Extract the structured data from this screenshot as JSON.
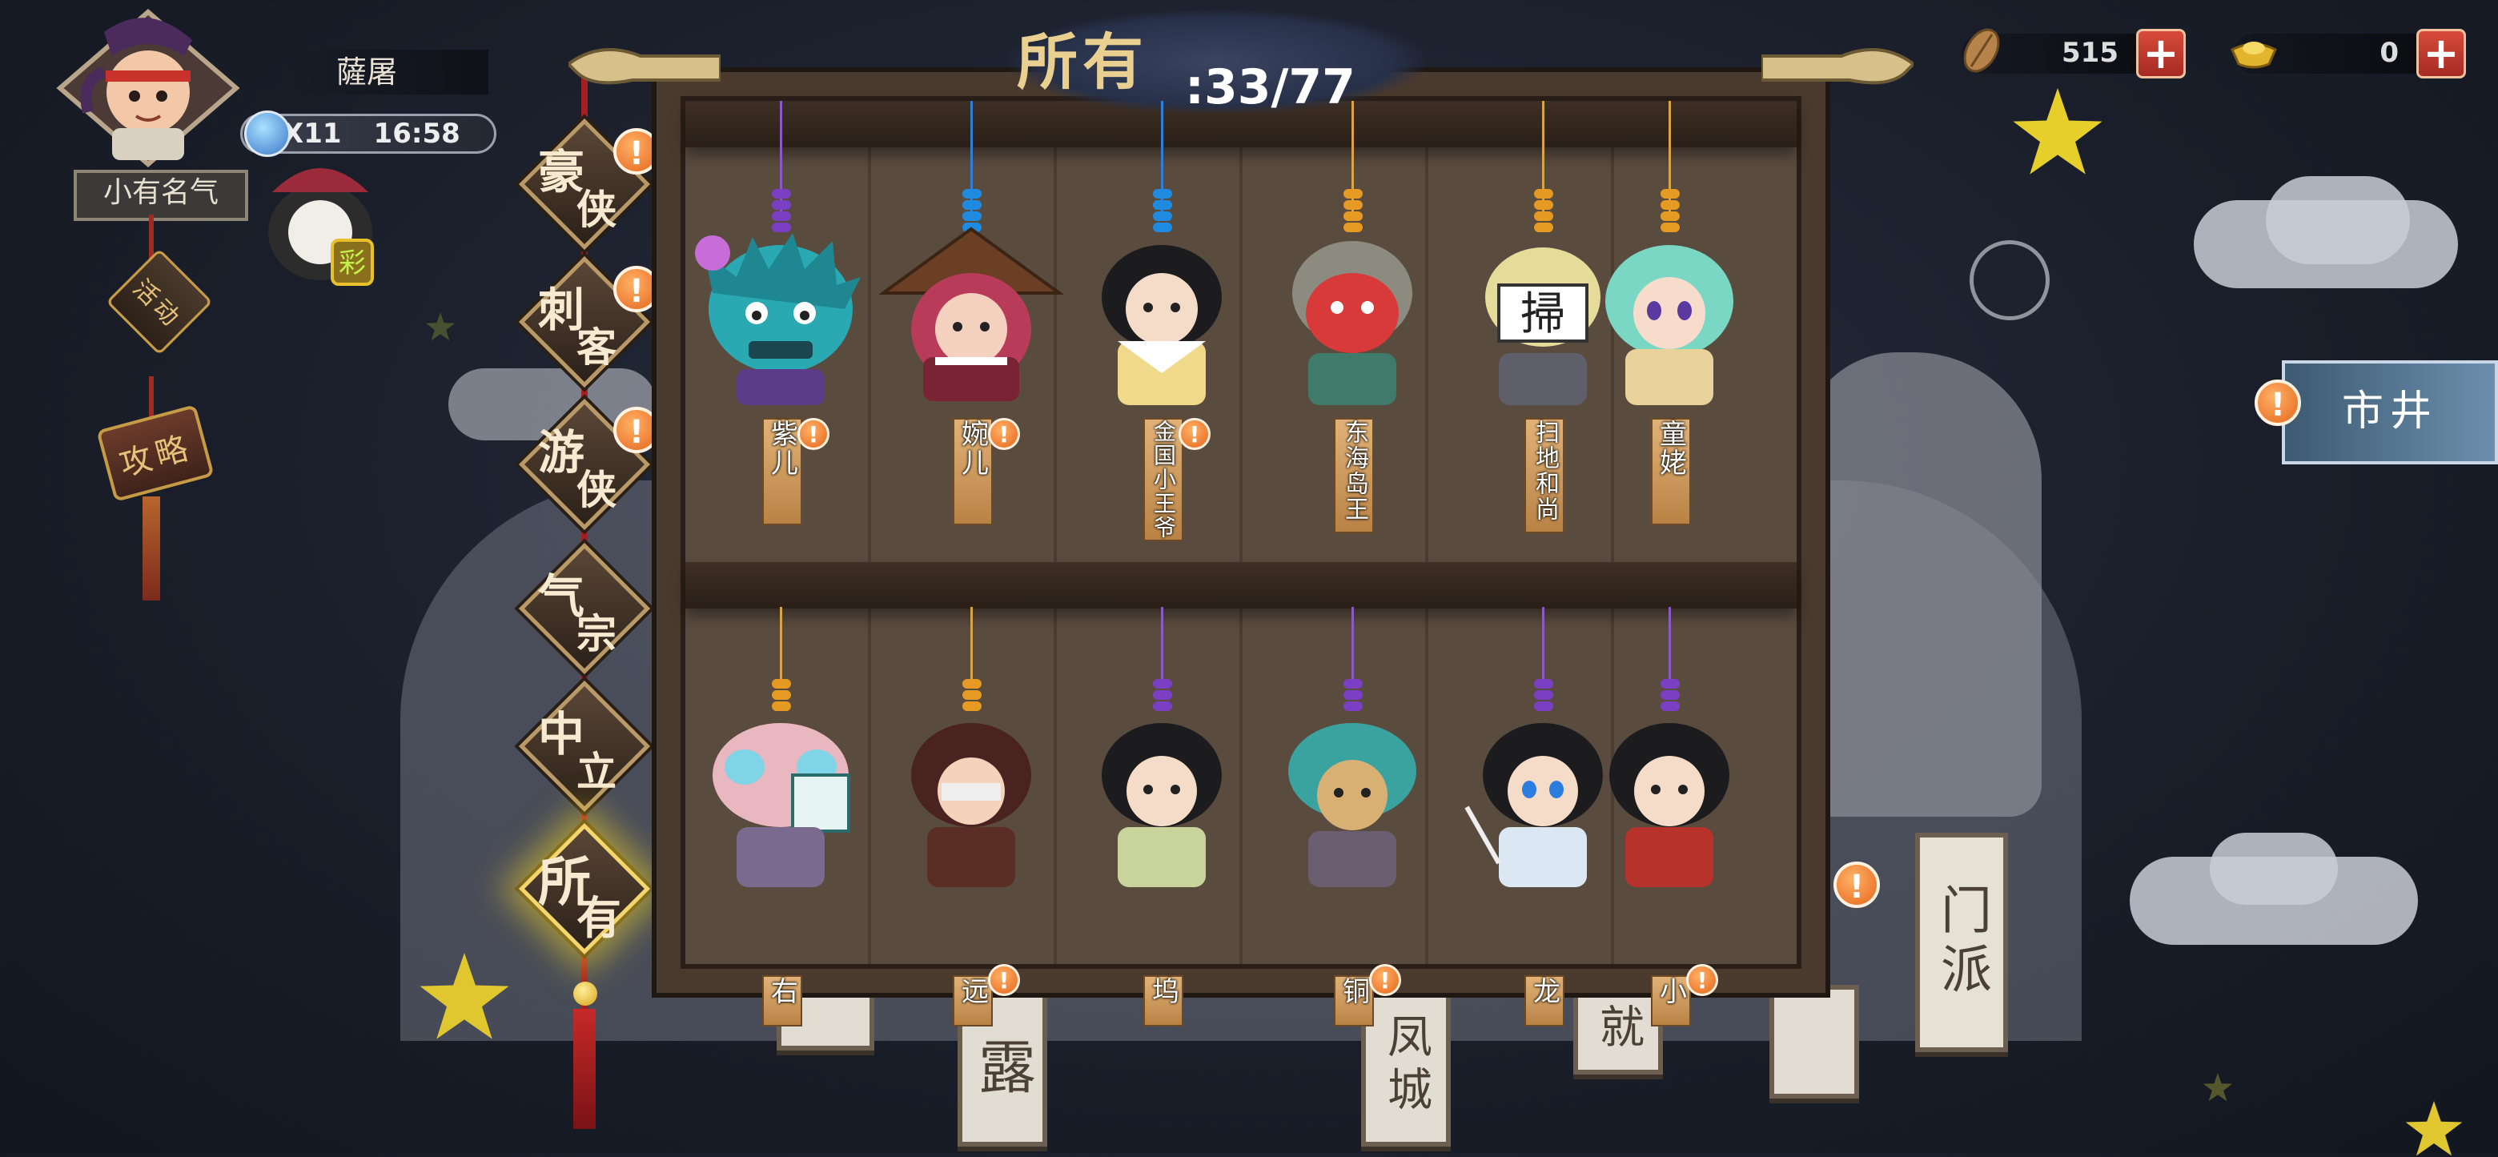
{
  "player": {
    "name": "薩屠",
    "stamina_count": "X11",
    "timer": "16:58",
    "rank_title": "小有名气"
  },
  "left_menu": [
    {
      "label": "活动"
    },
    {
      "label": "攻略"
    }
  ],
  "currencies": [
    {
      "icon": "leaf-coin-icon",
      "value": "515"
    },
    {
      "icon": "gold-ingot-icon",
      "value": "0"
    }
  ],
  "header": {
    "label": "所有",
    "count": ":33/77"
  },
  "categories": [
    {
      "t1": "豪",
      "t2": "侠",
      "alert": "!"
    },
    {
      "t1": "刺",
      "t2": "客",
      "alert": "!"
    },
    {
      "t1": "游",
      "t2": "侠",
      "alert": "!"
    },
    {
      "t1": "气",
      "t2": "宗",
      "alert": ""
    },
    {
      "t1": "中",
      "t2": "立",
      "alert": ""
    },
    {
      "t1": "所",
      "t2": "有",
      "alert": ""
    }
  ],
  "heroes_row1": [
    {
      "name": "紫儿",
      "alert": "!"
    },
    {
      "name": "婉儿",
      "alert": "!"
    },
    {
      "name": "金国小王爷",
      "alert": "!"
    },
    {
      "name": "东海岛王",
      "alert": ""
    },
    {
      "name": "扫地和尚",
      "alert": ""
    },
    {
      "name": "童姥",
      "alert": ""
    }
  ],
  "heroes_row2": [
    {
      "name": "右",
      "alert": ""
    },
    {
      "name": "远",
      "alert": "!"
    },
    {
      "name": "坞",
      "alert": ""
    },
    {
      "name": "铜",
      "alert": "!"
    },
    {
      "name": "龙",
      "alert": ""
    },
    {
      "name": "小",
      "alert": "!"
    }
  ],
  "right_panel": {
    "market_label": "市井",
    "alert": "!"
  },
  "sect_sign": {
    "label": "门派",
    "alert": "!"
  },
  "background_tablets": [
    "露",
    "凤城",
    "就"
  ]
}
